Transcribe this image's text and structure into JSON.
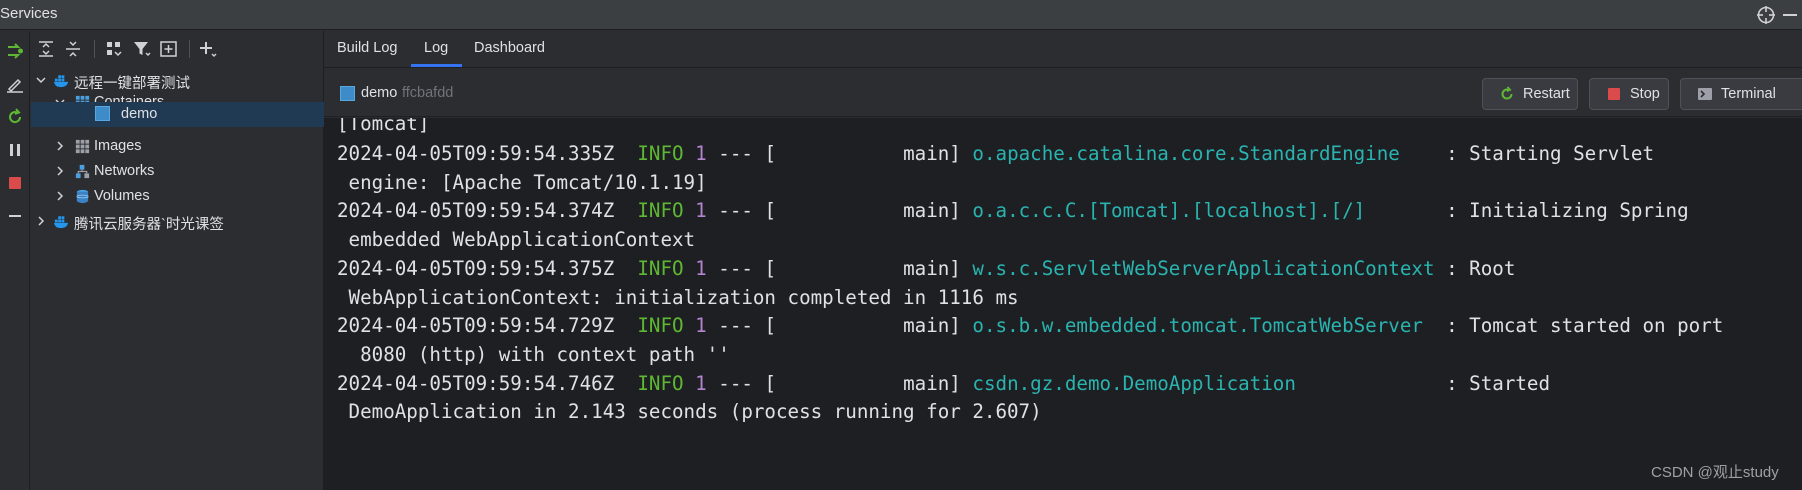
{
  "window": {
    "title": "Services"
  },
  "tree": {
    "items": [
      {
        "label": "远程一键部署测试",
        "expanded": true,
        "icon": "docker-icon"
      },
      {
        "label": "Containers",
        "expanded": true,
        "icon": "containers-icon"
      },
      {
        "label": "demo",
        "selected": true,
        "icon": "container-icon"
      },
      {
        "label": "Images",
        "expanded": false,
        "icon": "images-icon"
      },
      {
        "label": "Networks",
        "expanded": false,
        "icon": "networks-icon"
      },
      {
        "label": "Volumes",
        "expanded": false,
        "icon": "volumes-icon"
      },
      {
        "label": "腾讯云服务器`时光课签",
        "expanded": false,
        "icon": "docker-icon"
      }
    ]
  },
  "tabs": [
    {
      "label": "Build Log",
      "active": false
    },
    {
      "label": "Log",
      "active": true
    },
    {
      "label": "Dashboard",
      "active": false
    }
  ],
  "container": {
    "name": "demo",
    "id": "ffcbafdd"
  },
  "buttons": {
    "restart": "Restart",
    "stop": "Stop",
    "terminal": "Terminal"
  },
  "console": {
    "partial_top": "[Tomcat]",
    "entries": [
      {
        "timestamp": "2024-04-05T09:59:54.335Z",
        "level": "INFO",
        "pid": "1",
        "thread": "--- [           main]",
        "logger": "o.apache.catalina.core.StandardEngine   ",
        "message": ": Starting Servlet",
        "continuation": " engine: [Apache Tomcat/10.1.19]"
      },
      {
        "timestamp": "2024-04-05T09:59:54.374Z",
        "level": "INFO",
        "pid": "1",
        "thread": "--- [           main]",
        "logger": "o.a.c.c.C.[Tomcat].[localhost].[/]      ",
        "message": ": Initializing Spring",
        "continuation": " embedded WebApplicationContext"
      },
      {
        "timestamp": "2024-04-05T09:59:54.375Z",
        "level": "INFO",
        "pid": "1",
        "thread": "--- [           main]",
        "logger": "w.s.c.ServletWebServerApplicationContext",
        "message": ": Root",
        "continuation": " WebApplicationContext: initialization completed in 1116 ms"
      },
      {
        "timestamp": "2024-04-05T09:59:54.729Z",
        "level": "INFO",
        "pid": "1",
        "thread": "--- [           main]",
        "logger": "o.s.b.w.embedded.tomcat.TomcatWebServer ",
        "message": ": Tomcat started on port",
        "continuation": "  8080 (http) with context path ''"
      },
      {
        "timestamp": "2024-04-05T09:59:54.746Z",
        "level": "INFO",
        "pid": "1",
        "thread": "--- [           main]",
        "logger": "csdn.gz.demo.DemoApplication            ",
        "message": ": Started",
        "continuation": " DemoApplication in 2.143 seconds (process running for 2.607)"
      }
    ]
  },
  "watermark": "CSDN @观止study",
  "colors": {
    "info": "#5fb833",
    "pid": "#b584d1",
    "logger": "#2ab4b0",
    "selected_row": "#1f3a52",
    "tab_underline": "#3574f0"
  }
}
